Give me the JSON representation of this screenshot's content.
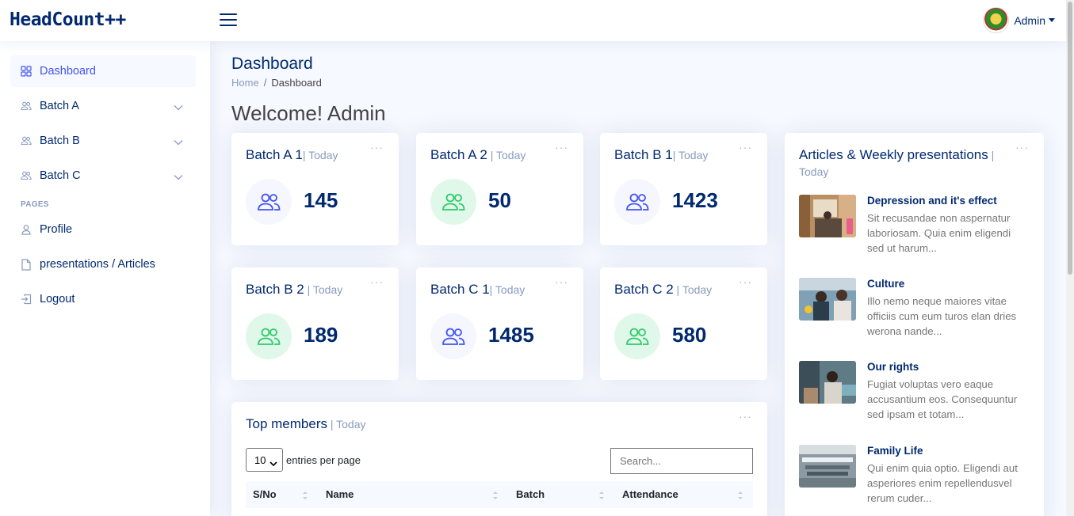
{
  "header": {
    "logo": "HeadCount++",
    "profile_name": "Admin"
  },
  "sidebar": {
    "items": [
      {
        "label": "Dashboard",
        "icon": "grid-icon"
      },
      {
        "label": "Batch A",
        "icon": "people-icon"
      },
      {
        "label": "Batch B",
        "icon": "people-icon"
      },
      {
        "label": "Batch C",
        "icon": "people-icon"
      }
    ],
    "heading": "PAGES",
    "pages": [
      {
        "label": "Profile",
        "icon": "person-icon"
      },
      {
        "label": "presentations / Articles",
        "icon": "file-icon"
      },
      {
        "label": "Logout",
        "icon": "logout-icon"
      }
    ]
  },
  "page": {
    "title": "Dashboard",
    "breadcrumb": [
      "Home",
      "/",
      "Dashboard"
    ],
    "welcome": "Welcome! Admin"
  },
  "stats": [
    {
      "title": "Batch A 1",
      "sub": "| Today",
      "value": "145",
      "color": "#4154f1"
    },
    {
      "title": "Batch A 2",
      "sub": " | Today",
      "value": "50",
      "color": "#2eca6a"
    },
    {
      "title": "Batch B 1",
      "sub": "| Today",
      "value": "1423",
      "color": "#4154f1"
    },
    {
      "title": "Batch B 2",
      "sub": " | Today",
      "value": "189",
      "color": "#2eca6a"
    },
    {
      "title": "Batch C 1",
      "sub": "| Today",
      "value": "1485",
      "color": "#4154f1"
    },
    {
      "title": "Batch C 2",
      "sub": " | Today",
      "value": "580",
      "color": "#2eca6a"
    }
  ],
  "top_members": {
    "title": "Top members",
    "sub": " | Today",
    "select_value": "10",
    "entries_label": "entries per page",
    "search_placeholder": "Search...",
    "columns": [
      "S/No",
      "Name",
      "Batch",
      "Attendance"
    ]
  },
  "articles": {
    "title": "Articles & Weekly presentations",
    "sep": " |",
    "sub": "Today",
    "items": [
      {
        "title": "Depression and it's effect",
        "body": "Sit recusandae non aspernatur laboriosam. Quia enim eligendi sed ut harum..."
      },
      {
        "title": "Culture",
        "body": "Illo nemo neque maiores vitae officiis cum eum turos elan dries werona nande..."
      },
      {
        "title": "Our rights",
        "body": "Fugiat voluptas vero eaque accusantium eos. Consequuntur sed ipsam et totam..."
      },
      {
        "title": "Family Life",
        "body": "Qui enim quia optio. Eligendi aut asperiores enim repellendusvel rerum cuder..."
      }
    ]
  },
  "colors": {
    "accent": "#4154f1",
    "navy": "#012970",
    "green": "#2eca6a",
    "muted": "#899bbd"
  }
}
